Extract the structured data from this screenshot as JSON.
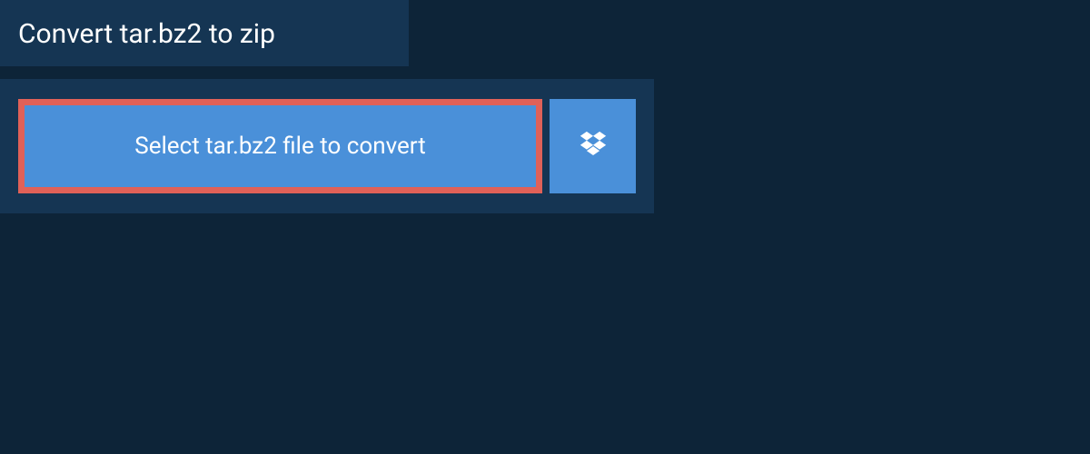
{
  "header": {
    "title": "Convert tar.bz2 to zip"
  },
  "actions": {
    "select_label": "Select tar.bz2 file to convert"
  },
  "colors": {
    "page_bg": "#0d2438",
    "panel_bg": "#153553",
    "button_bg": "#4a90d9",
    "highlight_border": "#e06158",
    "text": "#ffffff"
  }
}
